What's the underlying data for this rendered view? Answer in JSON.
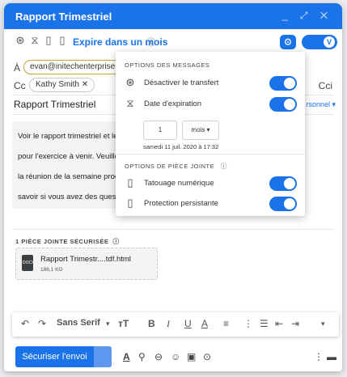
{
  "window": {
    "title": "Rapport Trimestriel",
    "controls": "_ ⤢ ✕"
  },
  "toolbar": {
    "expire_label": "Expire dans un mois",
    "toggle_glyph": "V"
  },
  "recipients": {
    "to_label": "À",
    "to_email": "evan@initechenterprises.c",
    "cc_label": "Cc",
    "cc_name": "Kathy Smith ✕",
    "cci_label": "Cci"
  },
  "subject": {
    "text": "Rapport Trimestriel",
    "personal": "rsonnel ▾"
  },
  "body": {
    "lines": [
      "Voir le rapport trimestriel et le",
      "pour l'exercice à venir. Veuille",
      "la réunion de la semaine proc",
      "savoir si vous avez des quest"
    ]
  },
  "popup": {
    "messages_header": "OPTIONS DES MESSAGES",
    "disable_forward": "Désactiver le transfert",
    "expiration_date": "Date d'expiration",
    "duration_value": "1",
    "duration_unit": "mois",
    "expires_on": "samedi 11 juil. 2020 à 17:32",
    "attachment_header": "OPTIONS DE PIÈCE JOINTE",
    "watermark": "Tatouage numérique",
    "persistent": "Protection persistante"
  },
  "toggles": {
    "disable_forward": true,
    "expiration": true,
    "watermark": true,
    "persistent": true
  },
  "attachments": {
    "header": "1 PIÈCE JOINTE SÉCURISÉE",
    "file_name": "Rapport Trimestr....tdf.html",
    "file_size": "186,1 KO",
    "file_badge": "DOCX"
  },
  "format": {
    "font": "Sans Serif"
  },
  "footer": {
    "send_label": "Sécuriser l'envoi"
  },
  "colors": {
    "accent": "#1a73e8",
    "email_chip_border": "#c9a23a"
  }
}
